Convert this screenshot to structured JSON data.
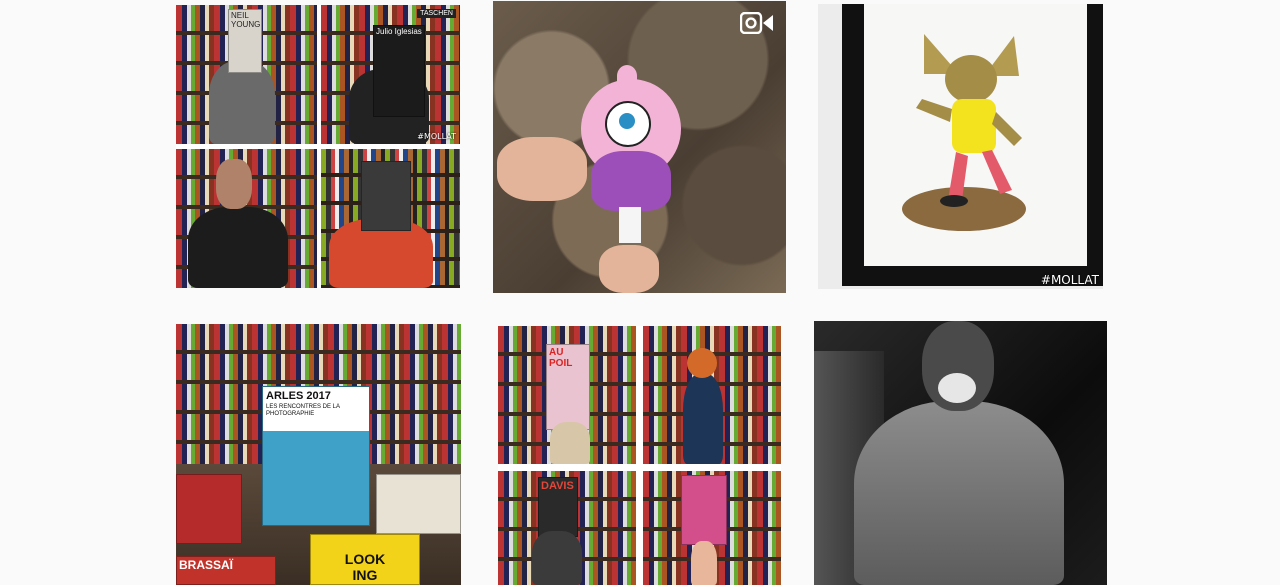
{
  "grid": {
    "tiles": [
      {
        "book_labels": [
          "NEIL YOUNG",
          "TASCHEN",
          "Julio Iglesias"
        ],
        "watermark": "#MOLLAT"
      },
      {
        "video_icon": "video-camera-icon"
      },
      {
        "watermark": "#MOLLAT"
      },
      {
        "cover_title": "ARLES 2017",
        "cover_subtitle": "LES RENCONTRES DE LA PHOTOGRAPHIE",
        "book_bottom_left": "BRASSAÏ",
        "book_bottom_right": "LOOK\nING"
      },
      {
        "book_labels": [
          "AU POIL",
          "DAVIS"
        ]
      },
      {}
    ]
  },
  "colors": {
    "page_background": "#fafafa",
    "frame": "#111111"
  }
}
